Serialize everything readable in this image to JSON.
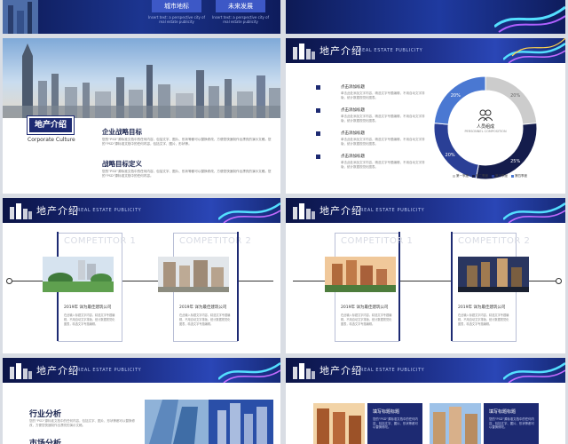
{
  "colors": {
    "navy": "#1d2a72",
    "accent": "#3d58c6",
    "page_bg": "#d9dde4"
  },
  "slide1": {
    "buttons": [
      {
        "label": "城市地标",
        "sub": "Insert text: a perspective city of real estate publicity"
      },
      {
        "label": "未来发展",
        "sub": "Insert text: a perspective city of real estate publicity"
      }
    ]
  },
  "header": {
    "title": "地产介绍",
    "subtitle": "REAL ESTATE PUBLICITY"
  },
  "slide3": {
    "tag": "地产介绍",
    "tag_en": "Corporate Culture",
    "goal1_title": "企业战略目标",
    "goal1_text": "您的“PSD”源标准文档中的任何内容，包括文字、图片、形状等都可以替换修改，方便您快速制作出漂亮的演示文稿。您的“PSD”源标准文档中的任何内容，包括文字、图片、形状等。",
    "goal2_title": "战略目标定义",
    "goal2_text": "您的“PSD”源标准文档中的任何内容，包括文字、图片、形状等都可以替换修改，方便您快速制作出漂亮的演示文稿。您的“PSD”源标准文档中的任何内容。"
  },
  "slide4": {
    "bullets": [
      {
        "title": "点击添加标题",
        "text": "单击此处添加文字内容，精选文字专题编辑，不用自动文字排版，统计数据视觉化图表。"
      },
      {
        "title": "点击添加标题",
        "text": "单击此处添加文字内容，精选文字专题编辑，不用自动文字排版，统计数据视觉化图表。"
      },
      {
        "title": "点击添加标题",
        "text": "单击此处添加文字内容，精选文字专题编辑，不用自动文字排版，统计数据视觉化图表。"
      },
      {
        "title": "点击添加标题",
        "text": "单击此处添加文字内容，精选文字专题编辑，不用自动文字排版，统计数据视觉化图表。"
      }
    ],
    "center_title": "人员组成",
    "center_sub": "PERSONNEL COMPOSITION",
    "legend": [
      "第一季度",
      "第二季度",
      "第三季度",
      "第四季度"
    ]
  },
  "chart_data": {
    "type": "pie",
    "categories": [
      "第一季度",
      "第二季度",
      "第三季度",
      "第四季度"
    ],
    "values": [
      20,
      25,
      20,
      20
    ],
    "labels": [
      "20%",
      "25%",
      "20%",
      "20%"
    ],
    "colors": [
      "#cccccc",
      "#141c4c",
      "#2a3f96",
      "#4a78d2"
    ]
  },
  "competitors": {
    "left": [
      {
        "title": "COMPETITOR 1",
        "heading": "2019年 详为最佳建筑公司",
        "text": "在此输入标题文字内容，精选文字专题编辑，不用自动文字排版，统计数据视觉化图表，精选文字专题编辑。"
      },
      {
        "title": "COMPETITOR 2",
        "heading": "2019年 详为最佳建筑公司",
        "text": "在此输入标题文字内容，精选文字专题编辑，不用自动文字排版，统计数据视觉化图表，精选文字专题编辑。"
      }
    ],
    "right": [
      {
        "title": "COMPETITOR 1",
        "heading": "2019年 详为最佳建筑公司",
        "text": "在此输入标题文字内容，精选文字专题编辑，不用自动文字排版，统计数据视觉化图表，精选文字专题编辑。"
      },
      {
        "title": "COMPETITOR 2",
        "heading": "2019年 详为最佳建筑公司",
        "text": "在此输入标题文字内容，精选文字专题编辑，不用自动文字排版，统计数据视觉化图表，精选文字专题编辑。"
      }
    ]
  },
  "slide7": {
    "title1": "行业分析",
    "text1": "您的“PSD”源标准文档中的任何内容，包括文字、图片、形状等都可以替换修改，方便您快速制作出漂亮的演示文稿。",
    "title2": "市场分析"
  },
  "slide8": {
    "boxes": [
      {
        "title": "填写标题标题",
        "text": "您的“PSD”源标准文档中的任何内容，包括文字、图片、形状等都可以替换修改。"
      },
      {
        "title": "填写标题标题",
        "text": "您的“PSD”源标准文档中的任何内容，包括文字、图片、形状等都可以替换修改。"
      }
    ]
  }
}
